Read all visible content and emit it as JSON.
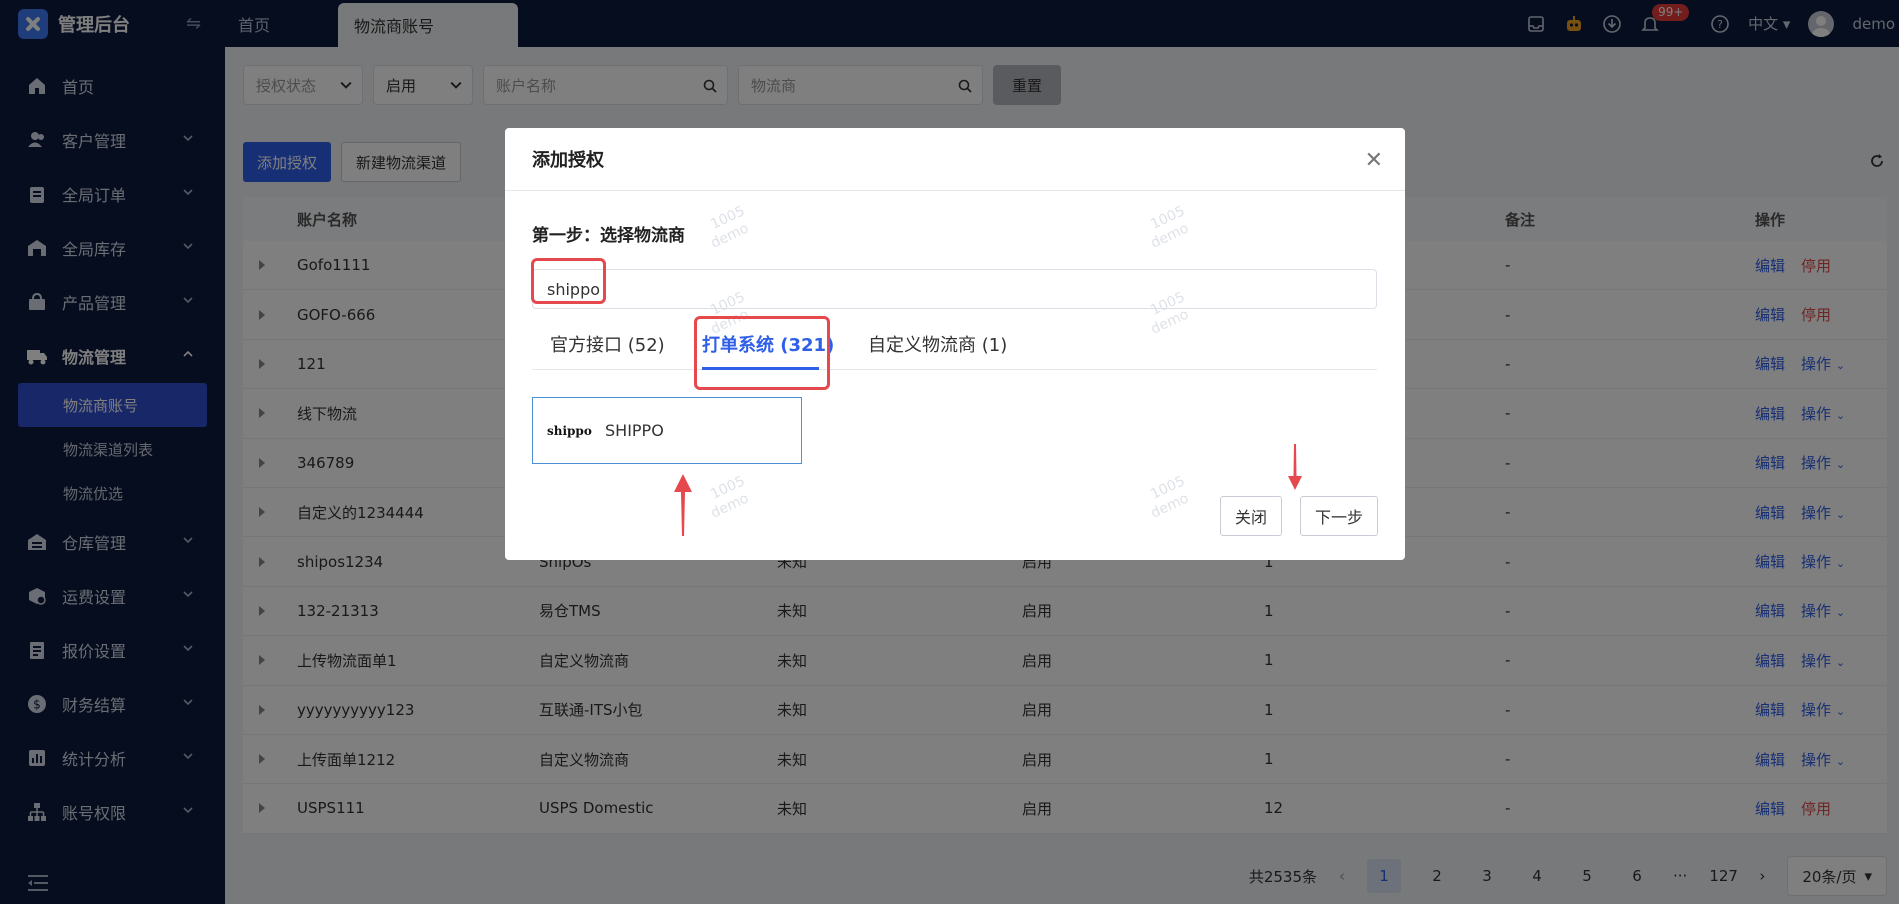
{
  "app": {
    "title": "管理后台"
  },
  "sidebar": {
    "items": [
      {
        "label": "首页",
        "icon": "home-icon"
      },
      {
        "label": "客户管理",
        "icon": "users-icon"
      },
      {
        "label": "全局订单",
        "icon": "clipboard-icon"
      },
      {
        "label": "全局库存",
        "icon": "warehouse-icon"
      },
      {
        "label": "产品管理",
        "icon": "bag-icon"
      },
      {
        "label": "物流管理",
        "icon": "truck-icon"
      }
    ],
    "sub_items": [
      {
        "label": "物流商账号"
      },
      {
        "label": "物流渠道列表"
      },
      {
        "label": "物流优选"
      }
    ],
    "items_after": [
      {
        "label": "仓库管理",
        "icon": "storage-icon"
      },
      {
        "label": "运费设置",
        "icon": "shipping-fee-icon"
      },
      {
        "label": "报价设置",
        "icon": "quote-icon"
      },
      {
        "label": "财务结算",
        "icon": "dollar-icon"
      },
      {
        "label": "统计分析",
        "icon": "chart-icon"
      },
      {
        "label": "账号权限",
        "icon": "org-icon"
      }
    ]
  },
  "header": {
    "tabs": [
      {
        "label": "首页"
      },
      {
        "label": "物流商账号"
      }
    ],
    "notification_badge": "99+",
    "language": "中文",
    "user": "demo"
  },
  "filters": {
    "auth_status_placeholder": "授权状态",
    "status_value": "启用",
    "account_placeholder": "账户名称",
    "carrier_placeholder": "物流商",
    "reset_label": "重置"
  },
  "toolbar": {
    "add_auth": "添加授权",
    "new_channel": "新建物流渠道"
  },
  "table": {
    "headers": {
      "name": "账户名称",
      "remark": "备注",
      "action": "操作"
    },
    "rows": [
      {
        "name": "Gofo1111",
        "provider": "",
        "type": "",
        "status": "",
        "count": "",
        "remark": "-",
        "op2": "停用"
      },
      {
        "name": "GOFO-666",
        "provider": "",
        "type": "",
        "status": "",
        "count": "",
        "remark": "-",
        "op2": "停用"
      },
      {
        "name": "121",
        "provider": "",
        "type": "",
        "status": "",
        "count": "",
        "remark": "-",
        "op2": "操作"
      },
      {
        "name": "线下物流",
        "provider": "",
        "type": "",
        "status": "",
        "count": "",
        "remark": "-",
        "op2": "操作"
      },
      {
        "name": "346789",
        "provider": "",
        "type": "",
        "status": "",
        "count": "",
        "remark": "-",
        "op2": "操作"
      },
      {
        "name": "自定义的1234444",
        "provider": "",
        "type": "",
        "status": "",
        "count": "",
        "remark": "-",
        "op2": "操作"
      },
      {
        "name": "shipos1234",
        "provider": "ShipOs",
        "type": "未知",
        "status": "启用",
        "count": "1",
        "remark": "-",
        "op2": "操作"
      },
      {
        "name": "132-21313",
        "provider": "易仓TMS",
        "type": "未知",
        "status": "启用",
        "count": "1",
        "remark": "-",
        "op2": "操作"
      },
      {
        "name": "上传物流面单1",
        "provider": "自定义物流商",
        "type": "未知",
        "status": "启用",
        "count": "1",
        "remark": "-",
        "op2": "操作"
      },
      {
        "name": "yyyyyyyyyy123",
        "provider": "互联通-ITS小包",
        "type": "未知",
        "status": "启用",
        "count": "1",
        "remark": "-",
        "op2": "操作"
      },
      {
        "name": "上传面单1212",
        "provider": "自定义物流商",
        "type": "未知",
        "status": "启用",
        "count": "1",
        "remark": "-",
        "op2": "操作"
      },
      {
        "name": "USPS111",
        "provider": "USPS Domestic",
        "type": "未知",
        "status": "启用",
        "count": "12",
        "remark": "-",
        "op2": "停用"
      }
    ],
    "edit_label": "编辑"
  },
  "pagination": {
    "total": "共2535条",
    "pages": [
      "1",
      "2",
      "3",
      "4",
      "5",
      "6"
    ],
    "ellipsis": "···",
    "last": "127",
    "page_size": "20条/页"
  },
  "modal": {
    "title": "添加授权",
    "step": "第一步：选择物流商",
    "search_value": "shippo",
    "tabs": [
      {
        "label": "官方接口 (52)"
      },
      {
        "label": "打单系统 (321)"
      },
      {
        "label": "自定义物流商 (1)"
      }
    ],
    "carrier_name": "SHIPPO",
    "carrier_logo_text": "shippo",
    "close_label": "关闭",
    "next_label": "下一步"
  },
  "watermark": [
    "1005",
    "demo"
  ],
  "colors": {
    "primary": "#2f5fe8",
    "danger": "#e04b4b",
    "sidebar_bg": "#0c1a3d",
    "highlight": "#e5484d"
  }
}
